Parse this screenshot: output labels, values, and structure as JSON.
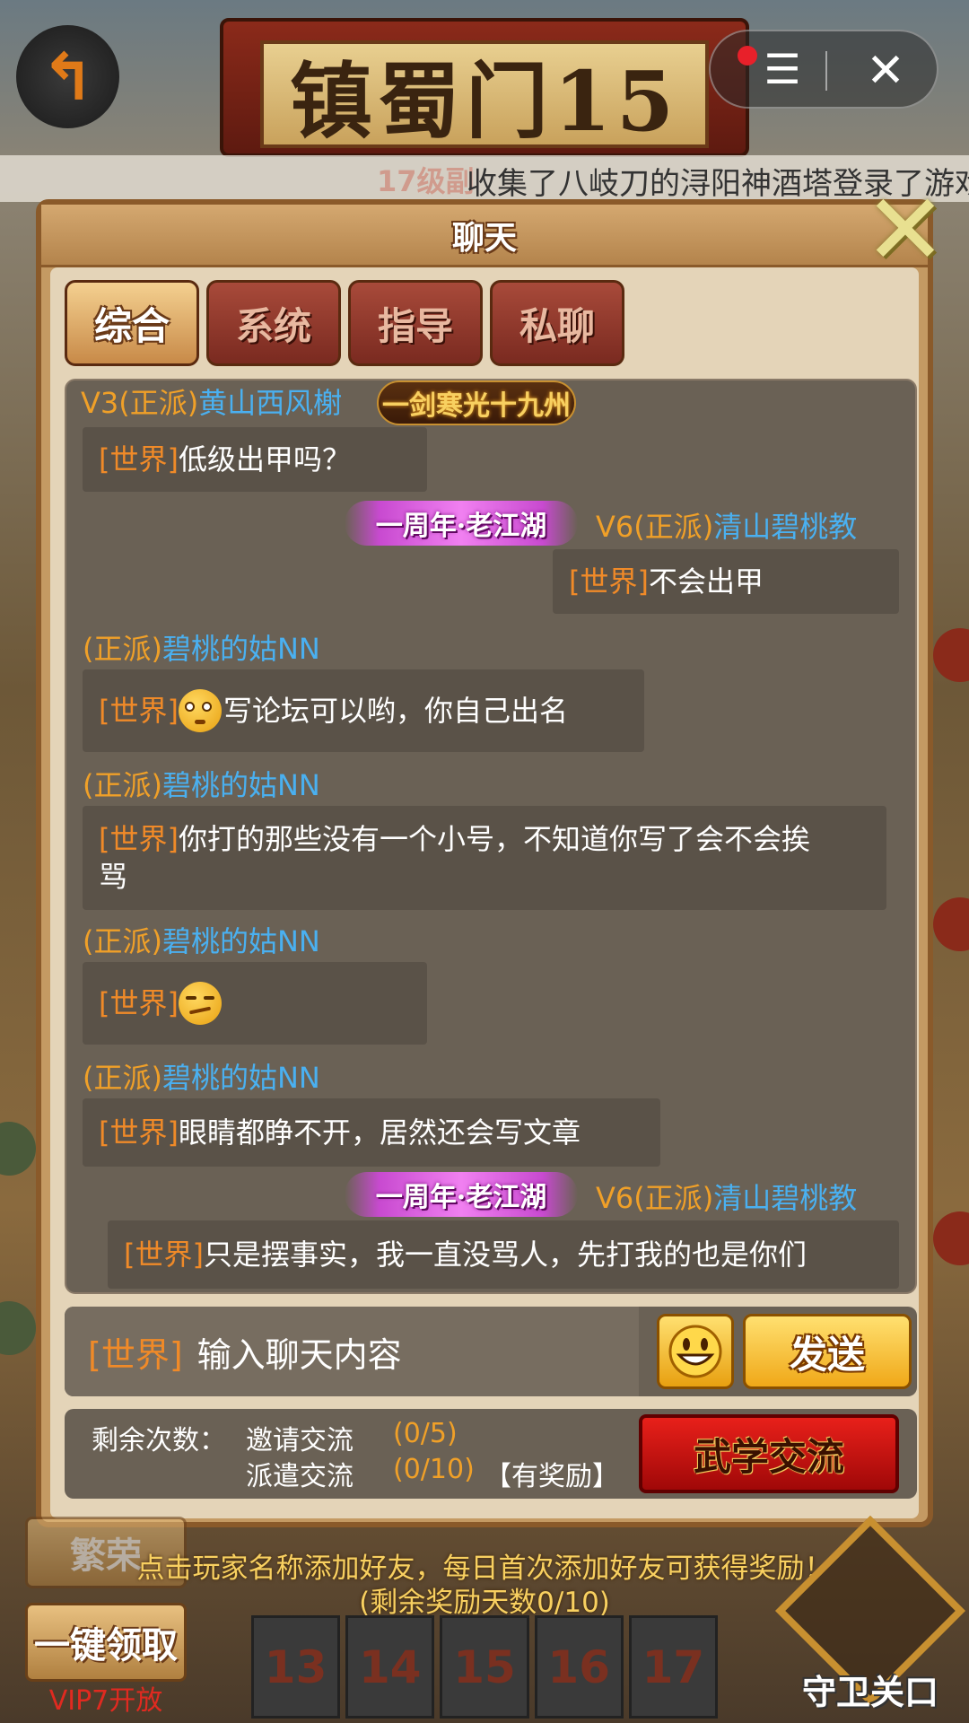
{
  "top": {
    "banner_title": "镇蜀门15",
    "back_icon": "back-arrow-icon",
    "capsule": {
      "menu_icon": "menu-icon",
      "close_icon": "close-icon",
      "close_glyph": "✕",
      "menu_glyph": "☰"
    },
    "marquee_ghost": "17级副",
    "marquee_text": "收集了八岐刀的浔阳神酒塔登录了游戏"
  },
  "modal": {
    "title": "聊天",
    "close_glyph": "✕",
    "tabs": [
      {
        "label": "综合",
        "active": true
      },
      {
        "label": "系统",
        "active": false
      },
      {
        "label": "指导",
        "active": false
      },
      {
        "label": "私聊",
        "active": false
      }
    ],
    "messages": [
      {
        "vip": "V3(正派)",
        "name": "黄山西风榭",
        "badge": "一剑寒光十九州",
        "tag": "[世界]",
        "text": "低级出甲吗？"
      },
      {
        "badge": "一周年·老江湖",
        "vip": "V6(正派)",
        "name": "清山碧桃教",
        "tag": "[世界]",
        "text": "不会出甲"
      },
      {
        "vip": "(正派)",
        "name": "碧桃的姑NN",
        "tag": "[世界]",
        "text": "写论坛可以哟，你自己出名",
        "emoji": "flushed-face-emoji"
      },
      {
        "vip": "(正派)",
        "name": "碧桃的姑NN",
        "tag": "[世界]",
        "text_line1": "你打的那些没有一个小号，不知道你写了会不会挨",
        "text_line2": "骂"
      },
      {
        "vip": "(正派)",
        "name": "碧桃的姑NN",
        "tag": "[世界]",
        "emoji": "smirk-face-emoji"
      },
      {
        "vip": "(正派)",
        "name": "碧桃的姑NN",
        "tag": "[世界]",
        "text": "眼睛都睁不开，居然还会写文章"
      },
      {
        "badge": "一周年·老江湖",
        "vip": "V6(正派)",
        "name": "清山碧桃教",
        "tag": "[世界]",
        "text": "只是摆事实，我一直没骂人，先打我的也是你们"
      }
    ],
    "input": {
      "channel": "[世界]",
      "placeholder": "输入聊天内容",
      "emoji_icon": "smiley-icon",
      "send_label": "发送"
    },
    "remain": {
      "label": "剩余次数：",
      "invite_label": "邀请交流",
      "invite_count": "(0/5)",
      "dispatch_label": "派遣交流",
      "dispatch_count": "(0/10)",
      "reward_note": "【有奖励】",
      "button_label": "武学交流"
    }
  },
  "bottom": {
    "hint_line1": "点击玩家名称添加好友，每日首次添加好友可获得奖励！",
    "hint_line2": "(剩余奖励天数0/10)",
    "fanrong_label": "繁荣",
    "one_key_label": "一键领取",
    "vip_note": "VIP7开放",
    "levels": [
      "13",
      "14",
      "15",
      "16",
      "17"
    ],
    "guard_label": "守卫关口"
  },
  "colors": {
    "vip": "#f0a028",
    "player": "#4ab0f0",
    "tag": "#f08a28",
    "bubble": "#5a5248",
    "panel": "#6a6155",
    "modal_frame": "#c49a63"
  }
}
